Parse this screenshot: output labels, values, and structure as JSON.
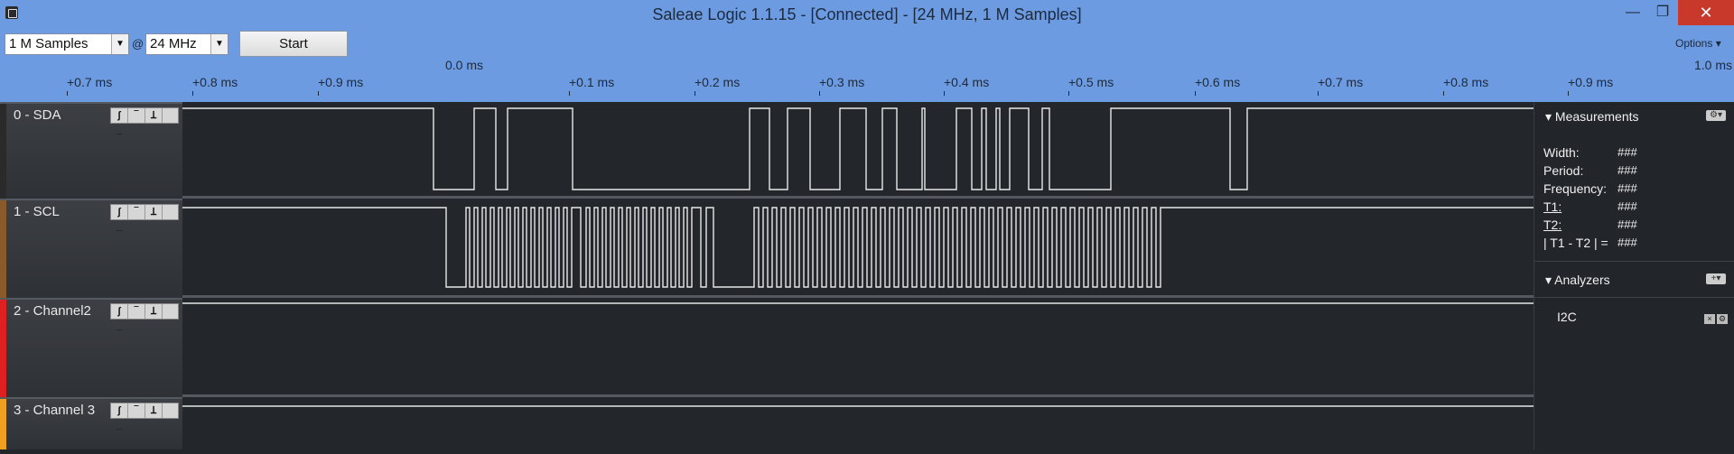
{
  "window": {
    "title": "Saleae Logic 1.1.15 - [Connected] - [24 MHz, 1 M Samples]",
    "minimize": "—",
    "maximize": "❐",
    "close": "✕"
  },
  "toolbar": {
    "samples": "1 M Samples",
    "at_symbol": "@",
    "rate": "24 MHz",
    "start": "Start",
    "options": "Options ▾"
  },
  "ruler": {
    "center": "0.0 ms",
    "end": "1.0 ms",
    "ticks": [
      "+0.7 ms",
      "+0.8 ms",
      "+0.9 ms",
      "+0.1 ms",
      "+0.2 ms",
      "+0.3 ms",
      "+0.4 ms",
      "+0.5 ms",
      "+0.6 ms",
      "+0.7 ms",
      "+0.8 ms",
      "+0.9 ms"
    ]
  },
  "channels": [
    {
      "name": "0 - SDA",
      "color": "#2a2a2a"
    },
    {
      "name": "1 - SCL",
      "color": "#8b5a2b"
    },
    {
      "name": "2 - Channel2",
      "color": "#e02020"
    },
    {
      "name": "3 - Channel 3",
      "color": "#f0a020"
    }
  ],
  "measurements": {
    "header": "Measurements",
    "width_label": "Width:",
    "width_value": "###",
    "period_label": "Period:",
    "period_value": "###",
    "freq_label": "Frequency:",
    "freq_value": "###",
    "t1_label": "T1:",
    "t1_value": "###",
    "t2_label": "T2:",
    "t2_value": "###",
    "diff_label": "| T1 - T2 | =",
    "diff_value": "###"
  },
  "analyzers": {
    "header": "Analyzers",
    "items": [
      "I2C"
    ]
  }
}
